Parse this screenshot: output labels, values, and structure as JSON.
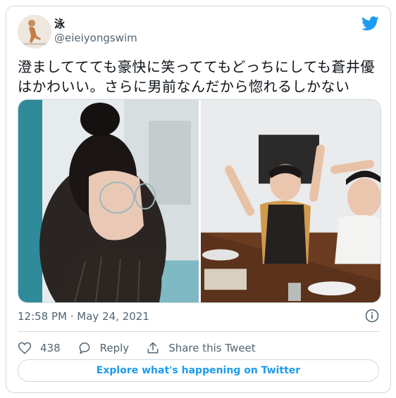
{
  "user": {
    "name": "泳",
    "handle": "@eieiyongswim"
  },
  "tweet": {
    "text": "澄ましててても豪快に笑っててもどっちにしても蒼井優はかわいい。さらに男前なんだから惚れるしかない"
  },
  "media": {
    "images": [
      {
        "description": "woman-with-glasses-photo"
      },
      {
        "description": "laughing-women-photo"
      }
    ]
  },
  "meta": {
    "timestamp": "12:58 PM · May 24, 2021"
  },
  "actions": {
    "like_count": "438",
    "reply_label": "Reply",
    "share_label": "Share this Tweet"
  },
  "footer": {
    "explore_label": "Explore what's happening on Twitter"
  },
  "colors": {
    "twitter_blue": "#1d9bf0",
    "secondary_text": "#536471",
    "border": "#cfd9de"
  },
  "icons": [
    "twitter-bird-icon",
    "info-icon",
    "heart-icon",
    "reply-icon",
    "share-icon"
  ]
}
